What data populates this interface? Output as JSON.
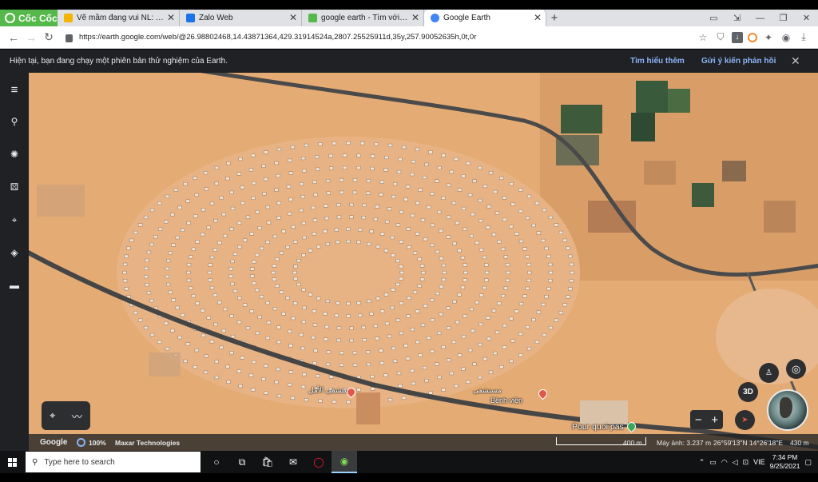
{
  "browser": {
    "brand": "Cốc Cốc",
    "tabs": [
      {
        "title": "Vẽ mầm đang vui NL: Tự nhiên",
        "active": false,
        "favicon_color": "#f4b400"
      },
      {
        "title": "Zalo Web",
        "active": false,
        "favicon_color": "#1a73e8"
      },
      {
        "title": "google earth - Tìm với Cốc Cốc",
        "active": false,
        "favicon_color": "#55b84a"
      },
      {
        "title": "Google Earth",
        "active": true,
        "favicon_color": "#4285f4"
      }
    ],
    "url": "https://earth.google.com/web/@26.98802468,14.43871364,429.31914524a,2807.25525911d,35y,257.90052635h,0t,0r"
  },
  "notice": {
    "message": "Hiện tại, bạn đang chạy một phiên bản thử nghiệm của Earth.",
    "learn_more": "Tìm hiểu thêm",
    "feedback": "Gửi ý kiến phản hồi"
  },
  "rail_icons": [
    "menu-icon",
    "search-icon",
    "voyager-icon",
    "dice-icon",
    "projects-icon",
    "layers-icon",
    "ruler-icon"
  ],
  "map": {
    "labels": [
      {
        "text": "Bệnh viện"
      },
      {
        "text": "Pour quoi pas"
      }
    ],
    "arabic_label": "مستشفى",
    "arabic_label2": "مستشفى الأمل",
    "view_3d": "3D",
    "colors": {
      "sand": "#e5ab74",
      "road": "#4a4a4a",
      "pin_red": "#e0584a",
      "pin_green": "#39a85b"
    }
  },
  "status": {
    "google": "Google",
    "load": "100%",
    "attribution": "Maxar Technologies",
    "scale": "400 m",
    "camera": "Máy ảnh: 3.237 m",
    "coords": "26°59'13\"N 14°26'18\"E",
    "altitude": "430 m"
  },
  "taskbar": {
    "search_placeholder": "Type here to search",
    "lang": "VIE",
    "time": "7:34 PM",
    "date": "9/25/2021"
  }
}
